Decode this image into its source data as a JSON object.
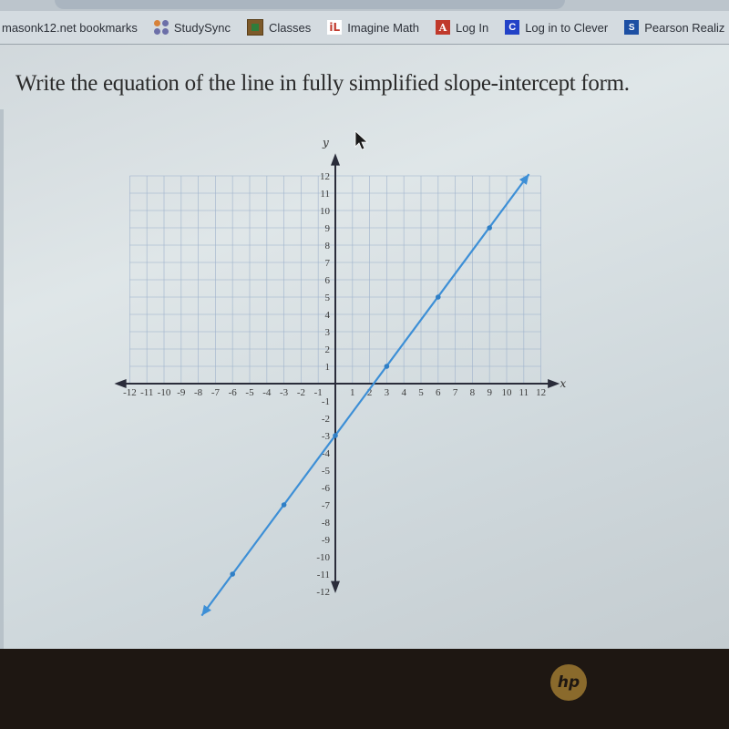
{
  "browser": {
    "bookmarks": [
      {
        "label": "masonk12.net bookmarks",
        "icon": "none"
      },
      {
        "label": "StudySync",
        "icon": "studysync-icon"
      },
      {
        "label": "Classes",
        "icon": "google-classroom-icon"
      },
      {
        "label": "Imagine Math",
        "icon": "imagine-math-icon"
      },
      {
        "label": "Log In",
        "icon": "login-a-icon",
        "glyph": "A"
      },
      {
        "label": "Log in to Clever",
        "icon": "clever-icon",
        "glyph": "C"
      },
      {
        "label": "Pearson Realiz",
        "icon": "pearson-icon",
        "glyph": "S"
      }
    ]
  },
  "question": {
    "prompt": "Write the equation of the line in fully simplified slope-intercept form."
  },
  "device": {
    "logo": "hp"
  },
  "chart_data": {
    "type": "line",
    "title": "",
    "xlabel": "x",
    "ylabel": "y",
    "xlim": [
      -12,
      12
    ],
    "ylim": [
      -12,
      12
    ],
    "grid": true,
    "grid_region": {
      "x": [
        -12,
        12
      ],
      "y": [
        0,
        12
      ]
    },
    "x_ticks": [
      -12,
      -11,
      -10,
      -9,
      -8,
      -7,
      -6,
      -5,
      -4,
      -3,
      -2,
      -1,
      1,
      2,
      3,
      4,
      5,
      6,
      7,
      8,
      9,
      10,
      11,
      12
    ],
    "y_ticks": [
      -12,
      -11,
      -10,
      -9,
      -8,
      -7,
      -6,
      -5,
      -4,
      -3,
      -2,
      -1,
      1,
      2,
      3,
      4,
      5,
      6,
      7,
      8,
      9,
      10,
      11,
      12
    ],
    "series": [
      {
        "name": "line",
        "color": "#3d8fd6",
        "slope": 1.3333,
        "intercept": -3,
        "arrow_ends": [
          [
            -7.8,
            -13.4
          ],
          [
            11.3,
            12.1
          ]
        ],
        "points": [
          [
            -6,
            -11
          ],
          [
            -3,
            -7
          ],
          [
            0,
            -3
          ],
          [
            3,
            1
          ],
          [
            6,
            5
          ],
          [
            9,
            9
          ]
        ]
      }
    ]
  }
}
